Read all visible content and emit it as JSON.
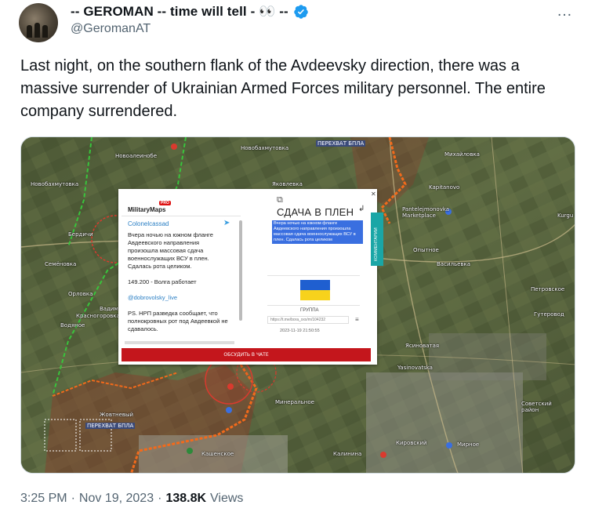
{
  "author": {
    "display_name": "-- GEROMAN -- time will tell - 👀 --",
    "handle": "@GeromanAT",
    "verified": true
  },
  "more_icon": "…",
  "tweet_text": "Last night, on the southern flank of the Avdeevsky direction, there was a massive surrender of Ukrainian Armed Forces military personnel. The entire company surrendered.",
  "media": {
    "map_labels": [
      "ПЕРЕХВАТ БПЛА",
      "Новобахмутовка",
      "Новоалеинобе",
      "Новобахмутовка",
      "Яковлевка",
      "Михайловка",
      "Kapitanovo",
      "Pantelejmonovka Marketplace",
      "Бердичи",
      "Семёновка",
      "Орловка",
      "Вадимовка",
      "Красногоровка",
      "Водяное",
      "Опытное",
      "Васильевка",
      "Петровское",
      "Гутеровод",
      "Ясиноватая",
      "Yasinovatska",
      "Минеральное",
      "Советский район",
      "Кировский",
      "Мирное",
      "Калинина",
      "Кашенское",
      "ПЕРЕХВАТ БПЛА",
      "Kurgu",
      "Жовтневый"
    ],
    "popup": {
      "logo": "MilitaryMaps",
      "logo_badge": "PRO",
      "channel": "Colonelcassad",
      "body_p1": "Вчера ночью на южном фланге Авдеевского направления произошла массовая сдача военнослужащих ВСУ в плен. Сдалась рота целиком.",
      "body_p2": "149.200 - Волга работает",
      "body_link": "@dobrovolsky_live",
      "body_p3": "PS. НРП разведка сообщает, что полнокровных рот под Авдеевкой не сдавалось.",
      "news_title": "СДАЧА В ПЛЕН",
      "news_highlight": "Вчера ночью на южном фланге Авдеевского направления произошла массовая сдача военнослужащих ВСУ в плен. Сдалась рота целиком",
      "group_label": "ГРУППА",
      "url": "https://t.me/bora_xxx/m/104232",
      "date": "2023-11-19 21:50:55",
      "side_tab": "КОММЕНТАРИИ",
      "discuss_button": "ОБСУДИТЬ В ЧАТЕ",
      "flag_colors": [
        "#1f5fd0",
        "#f7d21c"
      ]
    }
  },
  "footer": {
    "time": "3:25 PM",
    "separator1": "·",
    "date": "Nov 19, 2023",
    "separator2": "·",
    "views_count": "138.8K",
    "views_label": "Views"
  },
  "colors": {
    "text": "#0f1419",
    "secondary": "#536471",
    "verified_blue": "#1d9bf0",
    "front_line": "#f26a1b",
    "red_zone": "#d93a2e"
  }
}
